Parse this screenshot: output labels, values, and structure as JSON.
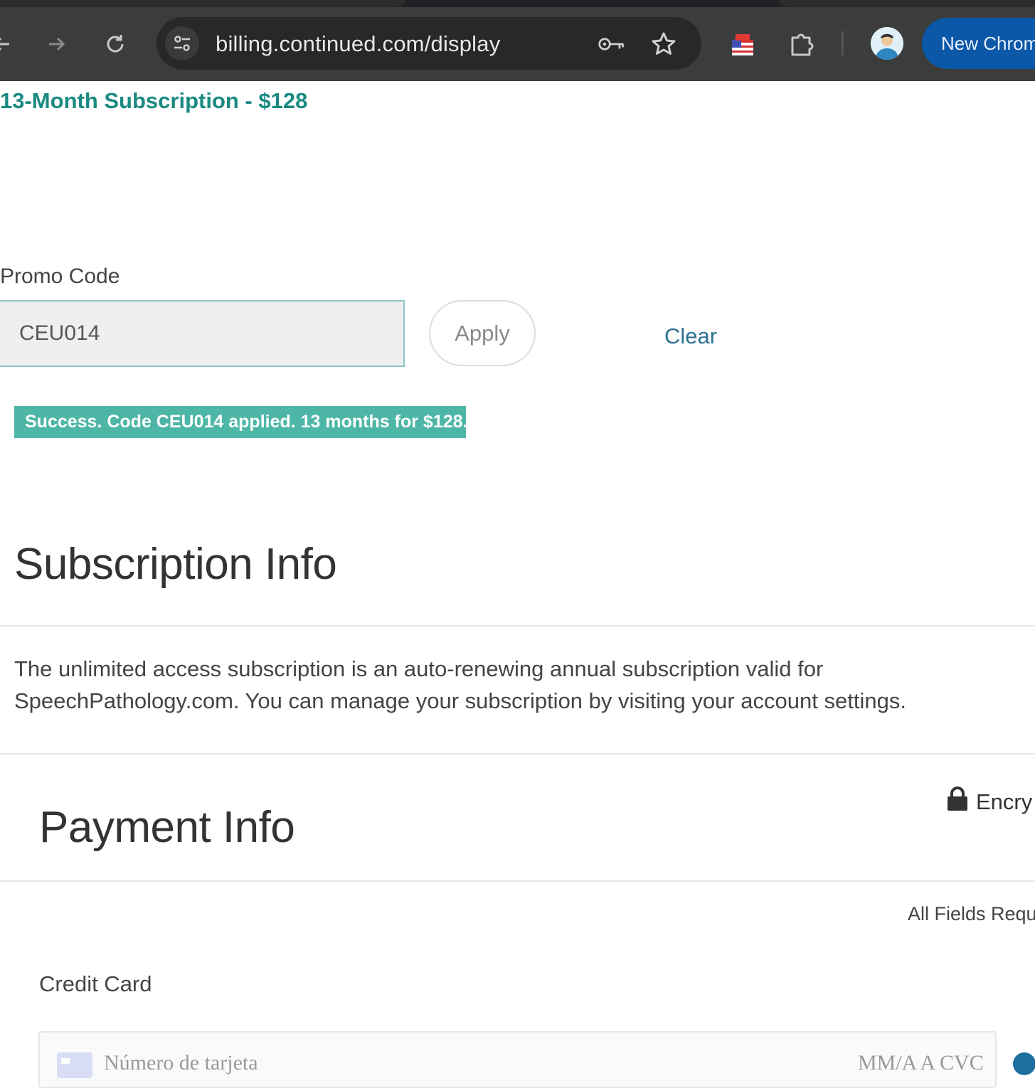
{
  "browser": {
    "url": "billing.continued.com/display",
    "new_chrome_label": "New Chrome",
    "icons": [
      "back-arrow-icon",
      "forward-arrow-icon",
      "reload-icon",
      "site-info-icon",
      "key-icon",
      "star-icon",
      "flag-extension-icon",
      "puzzle-extension-icon",
      "avatar"
    ]
  },
  "page": {
    "product_title": "13-Month Subscription - $128",
    "promo": {
      "label": "Promo Code",
      "value": "CEU014",
      "apply_label": "Apply",
      "clear_label": "Clear",
      "success_message": "Success. Code CEU014 applied. 13 months for $128."
    },
    "subscription": {
      "heading": "Subscription Info",
      "description": "The unlimited access subscription is an auto-renewing annual subscription valid for SpeechPathology.com. You can manage your subscription by visiting your account settings."
    },
    "payment": {
      "heading": "Payment Info",
      "encrypted_label": "Encry",
      "all_fields_label": "All Fields Requ",
      "credit_card_label": "Credit Card",
      "card_number_placeholder": "Número de tarjeta",
      "expiry_cvc_placeholder": "MM/A A CVC"
    }
  },
  "colors": {
    "accent_teal": "#1a8a82",
    "success_bg": "#4db6a6",
    "link_blue": "#2d7193",
    "chrome_dark": "#3c3c3c",
    "new_chrome_blue": "#0b57a8"
  }
}
